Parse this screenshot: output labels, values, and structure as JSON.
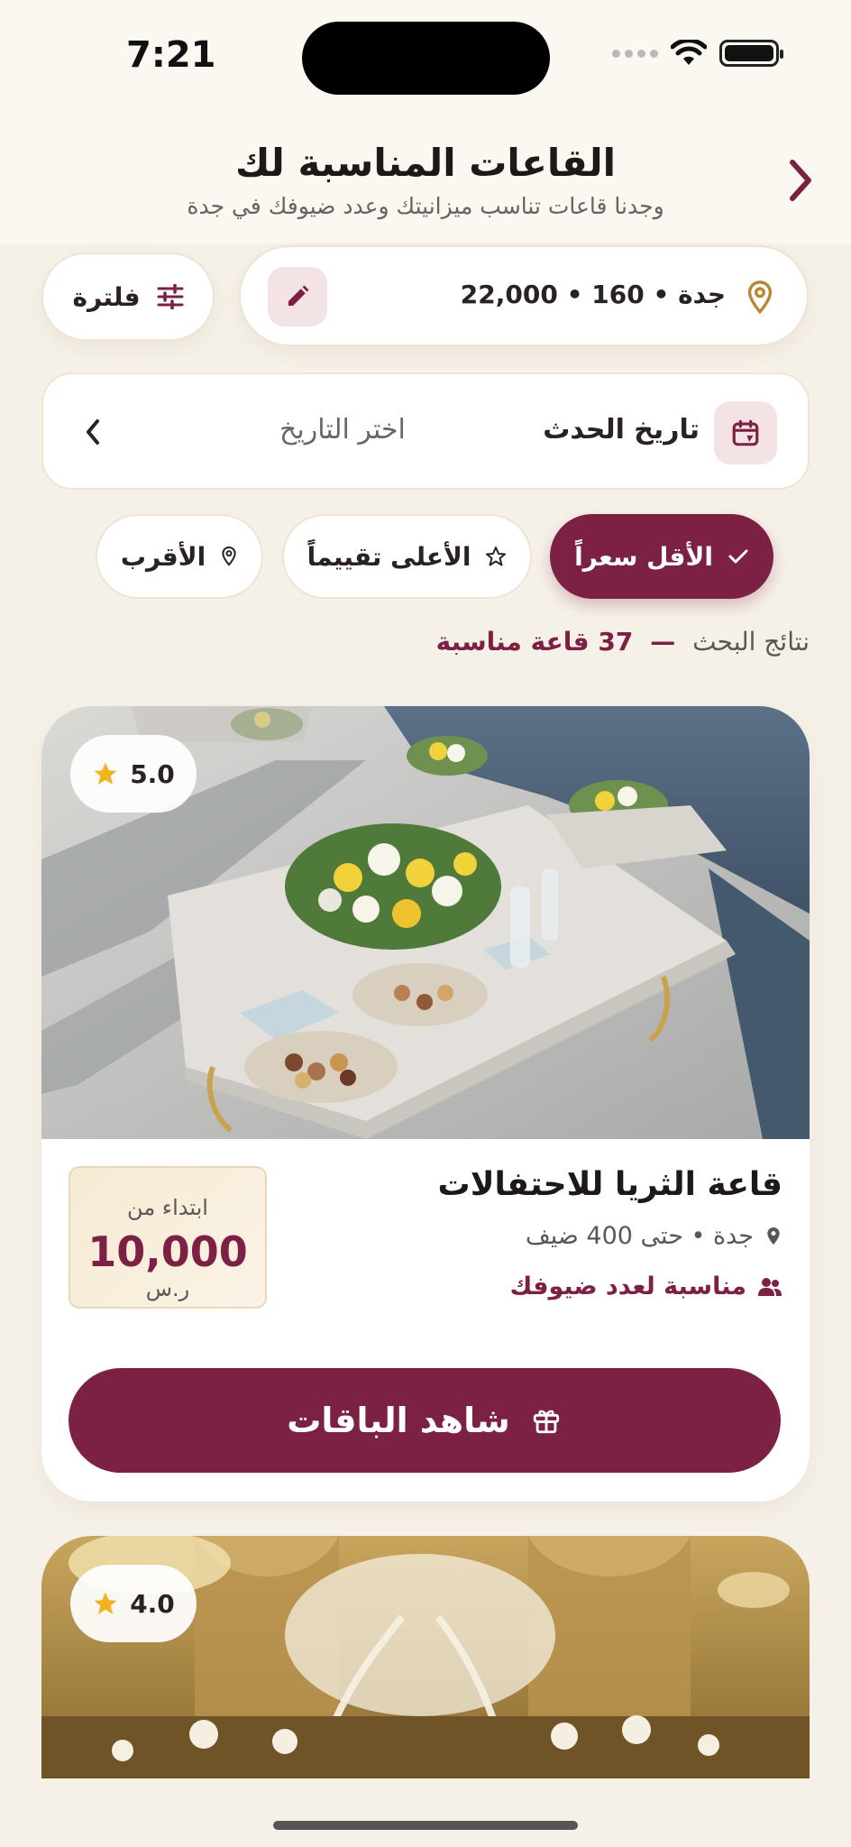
{
  "status_bar": {
    "time": "7:21"
  },
  "header": {
    "title": "القاعات المناسبة لك",
    "subtitle": "وجدنا قاعات تناسب ميزانيتك وعدد ضيوفك في جدة"
  },
  "search_summary": {
    "text": "جدة • 160 • 22,000"
  },
  "filter": {
    "label": "فلترة"
  },
  "date": {
    "label": "تاريخ الحدث",
    "placeholder": "اختر التاريخ"
  },
  "sort_chips": [
    {
      "label": "الأقل سعراً",
      "active": true
    },
    {
      "label": "الأعلى تقييماً",
      "active": false
    },
    {
      "label": "الأقرب",
      "active": false
    }
  ],
  "results": {
    "prefix": "نتائج البحث",
    "dash": "—",
    "count": "37 قاعة مناسبة"
  },
  "venues": [
    {
      "rating": "5.0",
      "name": "قاعة الثريا للاحتفالات",
      "location": "جدة • حتى 400 ضيف",
      "fit": "مناسبة لعدد ضيوفك",
      "price_from": "ابتداء من",
      "price": "10,000",
      "currency": "ر.س",
      "cta": "شاهد الباقات"
    },
    {
      "rating": "4.0"
    }
  ],
  "colors": {
    "brand": "#7c2144",
    "background": "#f6f1e8",
    "star": "#f2b41c",
    "gold": "#b8893a"
  }
}
